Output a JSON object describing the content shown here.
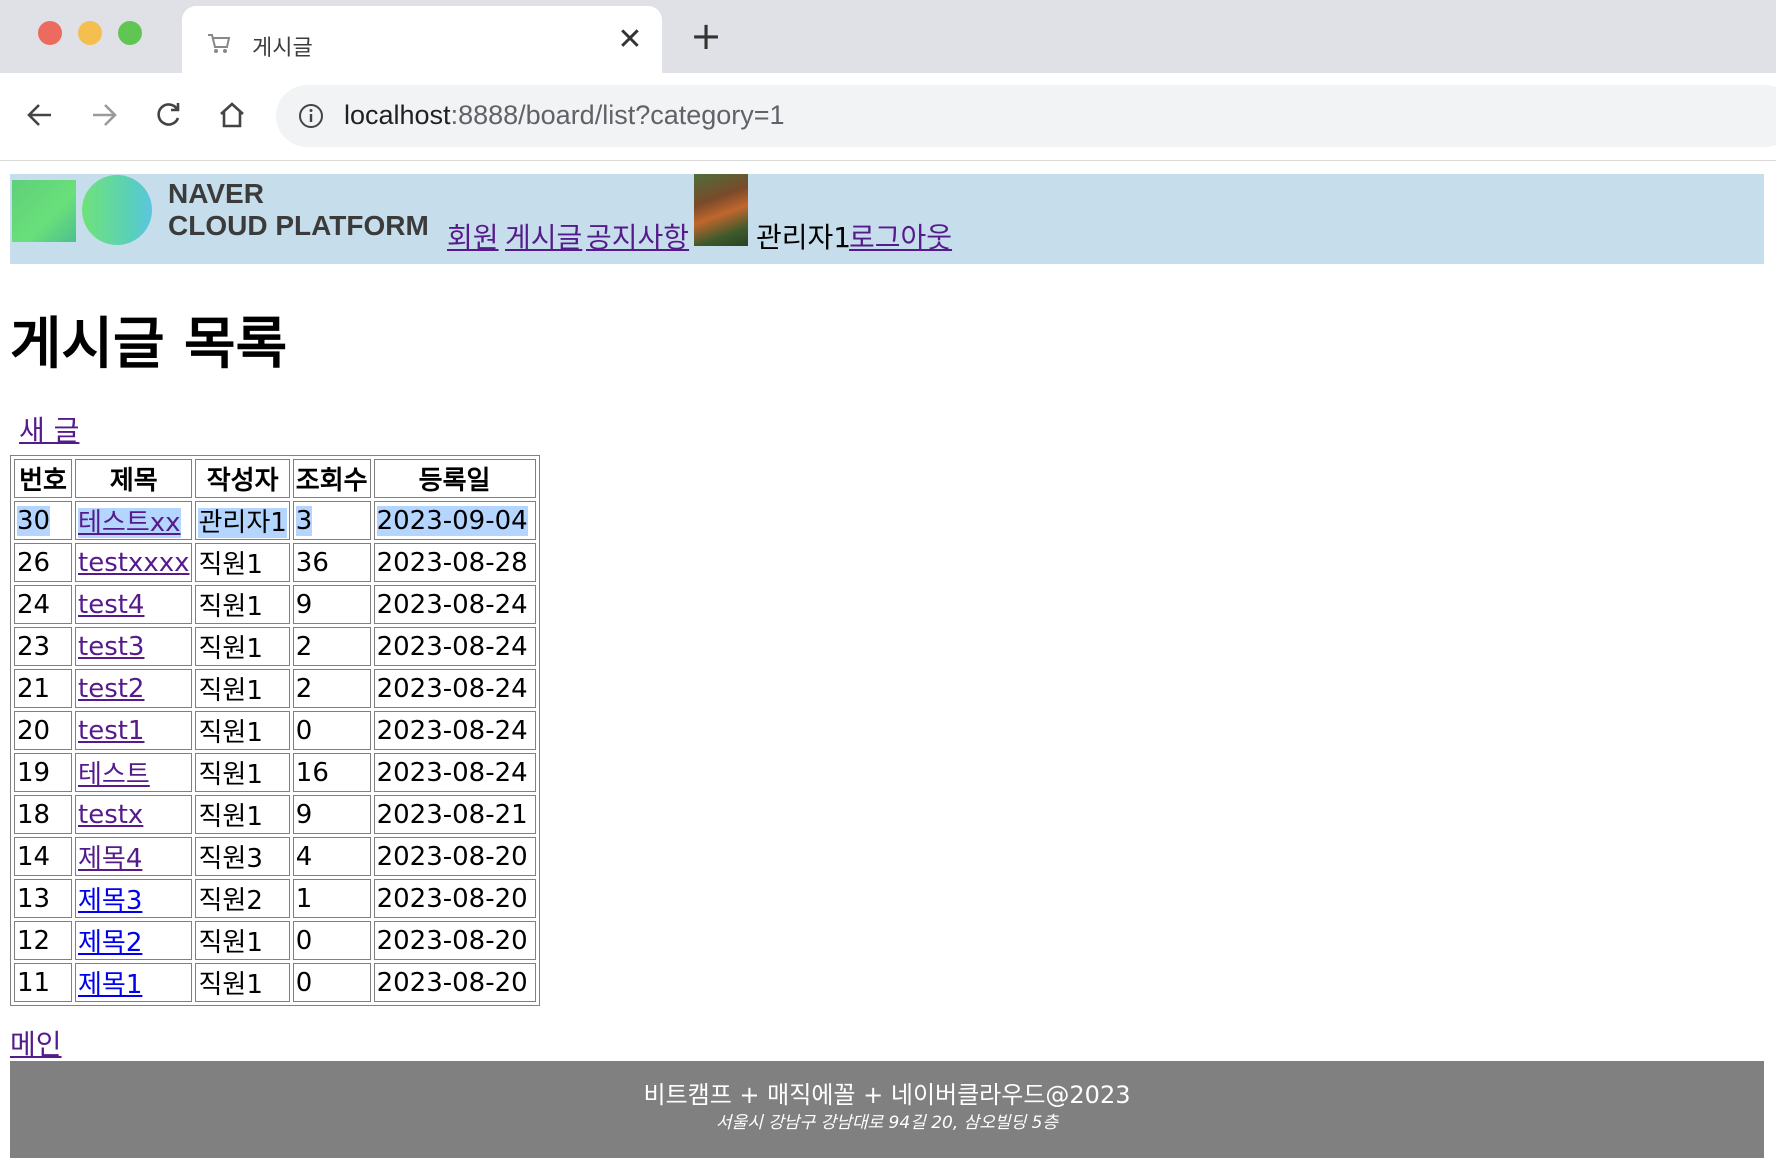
{
  "browser": {
    "tab_title": "게시글",
    "close_glyph": "✕",
    "new_tab_glyph": "+",
    "url_host": "localhost",
    "url_path": ":8888/board/list?category=1"
  },
  "header": {
    "logo_line1": "NAVER",
    "logo_line2": "CLOUD PLATFORM",
    "nav": [
      "회원",
      "게시글",
      "공지사항"
    ],
    "user_name": "관리자1",
    "logout": "로그아웃"
  },
  "page": {
    "title": "게시글 목록",
    "new_post": "새 글",
    "main_link": "메인"
  },
  "table": {
    "headers": [
      "번호",
      "제목",
      "작성자",
      "조회수",
      "등록일"
    ],
    "rows": [
      {
        "no": "30",
        "title": "테스트xx",
        "author": "관리자1",
        "views": "3",
        "date": "2023-09-04"
      },
      {
        "no": "26",
        "title": "testxxxx",
        "author": "직원1",
        "views": "36",
        "date": "2023-08-28"
      },
      {
        "no": "24",
        "title": "test4",
        "author": "직원1",
        "views": "9",
        "date": "2023-08-24"
      },
      {
        "no": "23",
        "title": "test3",
        "author": "직원1",
        "views": "2",
        "date": "2023-08-24"
      },
      {
        "no": "21",
        "title": "test2",
        "author": "직원1",
        "views": "2",
        "date": "2023-08-24"
      },
      {
        "no": "20",
        "title": "test1",
        "author": "직원1",
        "views": "0",
        "date": "2023-08-24"
      },
      {
        "no": "19",
        "title": "테스트",
        "author": "직원1",
        "views": "16",
        "date": "2023-08-24"
      },
      {
        "no": "18",
        "title": "testx",
        "author": "직원1",
        "views": "9",
        "date": "2023-08-21"
      },
      {
        "no": "14",
        "title": "제목4",
        "author": "직원3",
        "views": "4",
        "date": "2023-08-20"
      },
      {
        "no": "13",
        "title": "제목3",
        "author": "직원2",
        "views": "1",
        "date": "2023-08-20"
      },
      {
        "no": "12",
        "title": "제목2",
        "author": "직원1",
        "views": "0",
        "date": "2023-08-20"
      },
      {
        "no": "11",
        "title": "제목1",
        "author": "직원1",
        "views": "0",
        "date": "2023-08-20"
      }
    ]
  },
  "footer": {
    "main": "비트캠프 + 매직에꼴 + 네이버클라우드@2023",
    "address": "서울시 강남구 강남대로 94길 20, 삼오빌딩 5층"
  },
  "colors": {
    "header_bg": "#c6deeb",
    "footer_bg": "#808080",
    "visited_link": "#551a8b",
    "unvisited_link": "#0000ee",
    "selection": "#b4d5fe"
  }
}
